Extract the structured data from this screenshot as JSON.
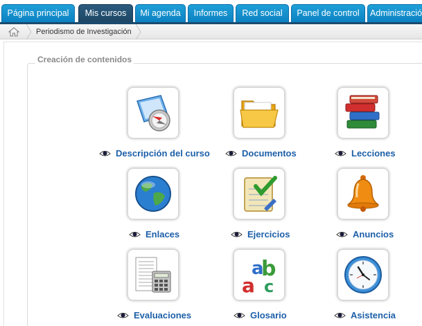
{
  "tabs": [
    {
      "label": "Página principal",
      "active": false
    },
    {
      "label": "Mis cursos",
      "active": true
    },
    {
      "label": "Mi agenda",
      "active": false
    },
    {
      "label": "Informes",
      "active": false
    },
    {
      "label": "Red social",
      "active": false
    },
    {
      "label": "Panel de control",
      "active": false
    },
    {
      "label": "Administración",
      "active": false
    }
  ],
  "breadcrumb": {
    "home_icon": "home-icon",
    "course": "Periodismo de Investigación"
  },
  "section": {
    "title": "Creación de contenidos"
  },
  "tools": [
    {
      "label": "Descripción del curso",
      "icon": "course-description-icon"
    },
    {
      "label": "Documentos",
      "icon": "folder-icon"
    },
    {
      "label": "Lecciones",
      "icon": "books-icon"
    },
    {
      "label": "Enlaces",
      "icon": "globe-icon"
    },
    {
      "label": "Ejercicios",
      "icon": "exercise-checklist-icon"
    },
    {
      "label": "Anuncios",
      "icon": "bell-icon"
    },
    {
      "label": "Evaluaciones",
      "icon": "calculator-icon"
    },
    {
      "label": "Glosario",
      "icon": "abc-icon"
    },
    {
      "label": "Asistencia",
      "icon": "clock-icon"
    }
  ],
  "colors": {
    "tab": "#0b7fc0",
    "tab_active": "#1d4564",
    "label": "#1c5fa8"
  }
}
